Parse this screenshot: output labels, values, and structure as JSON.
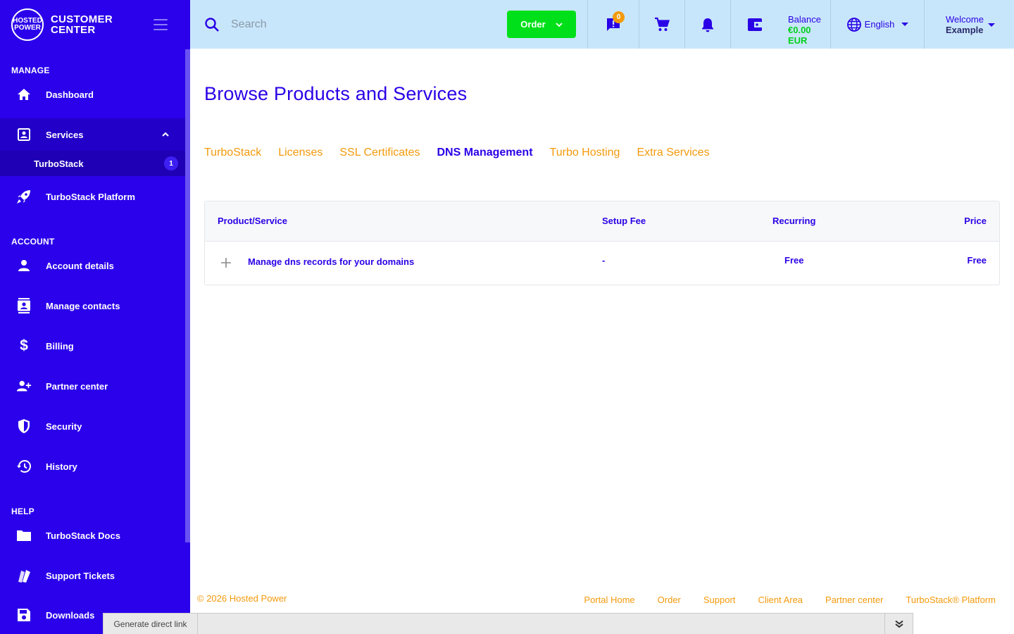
{
  "brand": {
    "logo_line1": "HOSTED",
    "logo_line2": "POWER",
    "name_line1": "CUSTOMER",
    "name_line2": "CENTER"
  },
  "sidebar": {
    "sections": {
      "manage": "MANAGE",
      "account": "ACCOUNT",
      "help": "HELP"
    },
    "items": {
      "dashboard": "Dashboard",
      "services": "Services",
      "turbostack": "TurboStack",
      "turbostack_badge": "1",
      "turbostack_platform": "TurboStack Platform",
      "account_details": "Account details",
      "manage_contacts": "Manage contacts",
      "billing": "Billing",
      "partner_center": "Partner center",
      "security": "Security",
      "history": "History",
      "turbostack_docs": "TurboStack Docs",
      "support_tickets": "Support Tickets",
      "downloads": "Downloads"
    }
  },
  "topbar": {
    "search_placeholder": "Search",
    "order_label": "Order",
    "messages_badge": "0",
    "balance_label": "Balance",
    "balance_value": "€0.00 EUR",
    "language": "English",
    "welcome_label": "Welcome",
    "welcome_name": "Example"
  },
  "main": {
    "title": "Browse Products and Services",
    "tabs": [
      "TurboStack",
      "Licenses",
      "SSL Certificates",
      "DNS Management",
      "Turbo Hosting",
      "Extra Services"
    ],
    "active_tab": "DNS Management",
    "table": {
      "headers": {
        "product": "Product/Service",
        "setup": "Setup Fee",
        "recurring": "Recurring",
        "price": "Price"
      },
      "rows": [
        {
          "product": "Manage dns records for your domains",
          "setup": "-",
          "recurring": "Free",
          "price": "Free"
        }
      ]
    }
  },
  "footer": {
    "copyright": "© 2026 Hosted Power",
    "links": [
      "Portal Home",
      "Order",
      "Support",
      "Client Area",
      "Partner center",
      "TurboStack® Platform"
    ]
  },
  "debug": {
    "button_label": "Generate direct link"
  },
  "colors": {
    "sidebar_bg": "#2b00ea",
    "topbar_bg": "#c8e6fb",
    "accent_orange": "#f39a0c",
    "order_green": "#00e01a",
    "primary": "#2a00e6"
  }
}
